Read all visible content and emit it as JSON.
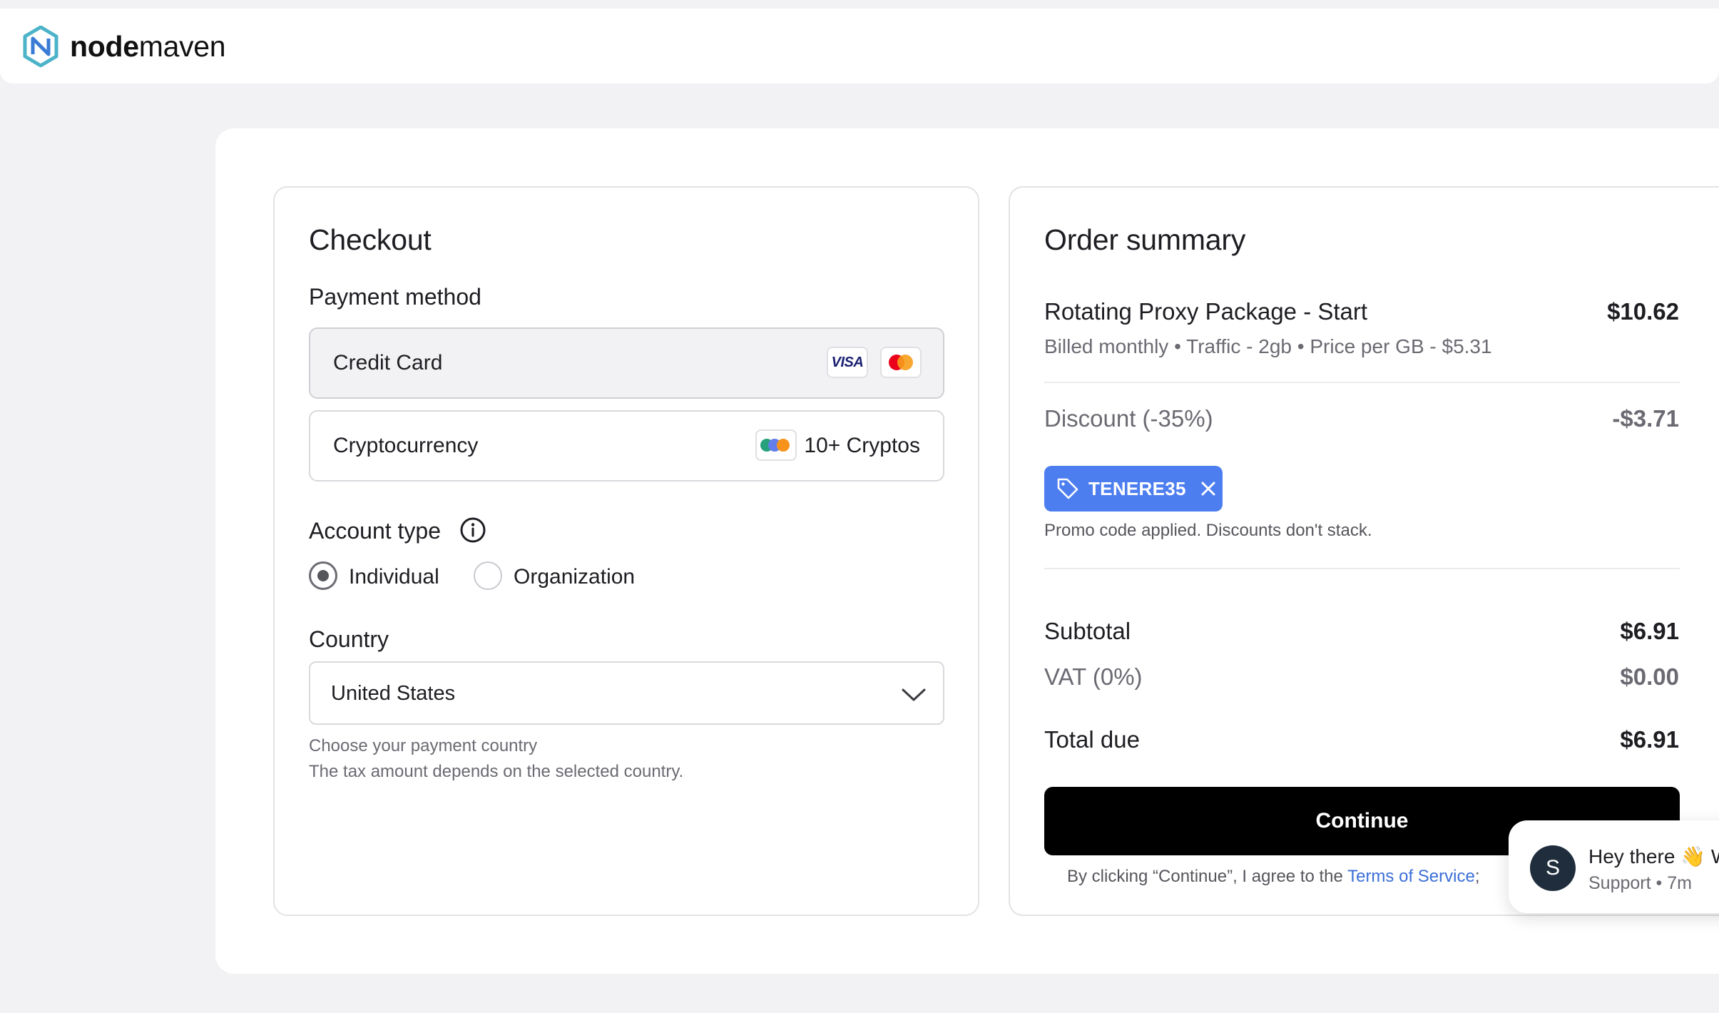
{
  "header": {
    "logo_bold": "node",
    "logo_light": "maven"
  },
  "checkout": {
    "title": "Checkout",
    "payment_method_label": "Payment method",
    "payment_options": [
      {
        "label": "Credit Card",
        "selected": true,
        "badges": [
          "VISA",
          "mastercard-icon"
        ]
      },
      {
        "label": "Cryptocurrency",
        "selected": false,
        "badge": "crypto-coins-icon",
        "extra": "10+ Cryptos"
      }
    ],
    "account_type_label": "Account type",
    "account_types": [
      {
        "label": "Individual",
        "checked": true
      },
      {
        "label": "Organization",
        "checked": false
      }
    ],
    "country_label": "Country",
    "country_value": "United States",
    "hint_line1": "Choose your payment country",
    "hint_line2": "The tax amount depends on the selected country."
  },
  "summary": {
    "title": "Order summary",
    "product_name": "Rotating Proxy Package - Start",
    "product_price": "$10.62",
    "product_details": "Billed monthly • Traffic - 2gb • Price per GB - $5.31",
    "discount_label": "Discount (-35%)",
    "discount_value": "-$3.71",
    "promo_code": "TENERE35",
    "promo_note": "Promo code applied. Discounts don't stack.",
    "subtotal_label": "Subtotal",
    "subtotal_value": "$6.91",
    "vat_label": "VAT (0%)",
    "vat_value": "$0.00",
    "total_label": "Total due",
    "total_value": "$6.91",
    "continue_label": "Continue",
    "agree_prefix": "By clicking “Continue”, I agree to the ",
    "agree_link": "Terms of Service",
    "agree_suffix": ";"
  },
  "chat": {
    "avatar_initial": "S",
    "message": "Hey there 👋 W",
    "meta": "Support • 7m"
  },
  "colors": {
    "accent": "#4d7ef0",
    "button": "#000000",
    "link": "#3b6fd8",
    "background": "#f2f2f4"
  }
}
